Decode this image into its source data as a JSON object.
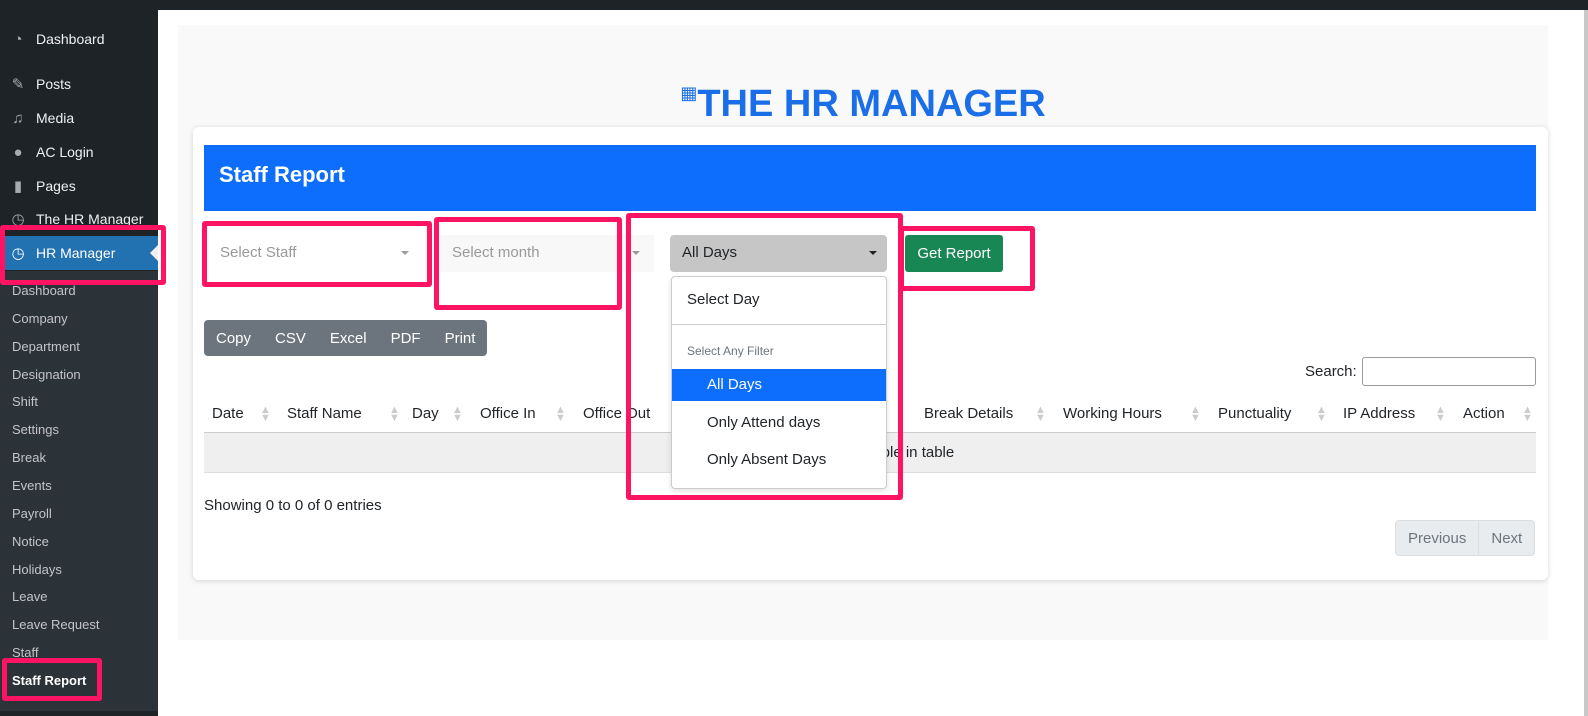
{
  "sidebar": {
    "items": [
      {
        "label": "Dashboard",
        "icon": "dashboard-icon"
      },
      {
        "label": "Posts",
        "icon": "pin-icon"
      },
      {
        "label": "Media",
        "icon": "media-icon"
      },
      {
        "label": "AC Login",
        "icon": "palette-icon"
      },
      {
        "label": "Pages",
        "icon": "pages-icon"
      },
      {
        "label": "The HR Manager",
        "icon": "clock-icon"
      },
      {
        "label": "HR Manager",
        "icon": "clock-icon"
      }
    ],
    "submenu": [
      "Dashboard",
      "Company",
      "Department",
      "Designation",
      "Shift",
      "Settings",
      "Break",
      "Events",
      "Payroll",
      "Notice",
      "Holidays",
      "Leave",
      "Leave Request",
      "Staff",
      "Staff Report"
    ]
  },
  "header": {
    "title": "THE HR MANAGER",
    "icon": "building-icon"
  },
  "card": {
    "title": "Staff Report"
  },
  "filters": {
    "staff_placeholder": "Select Staff",
    "month_placeholder": "Select month",
    "day_selected": "All Days",
    "get_report": "Get Report"
  },
  "day_menu": {
    "header_item": "Select Day",
    "group_label": "Select Any Filter",
    "options": [
      "All Days",
      "Only Attend days",
      "Only Absent Days"
    ],
    "selected": "All Days"
  },
  "export_buttons": [
    "Copy",
    "CSV",
    "Excel",
    "PDF",
    "Print"
  ],
  "search": {
    "label": "Search:",
    "value": ""
  },
  "table": {
    "columns": [
      "Date",
      "Staff Name",
      "Day",
      "Office In",
      "Office Out",
      "",
      "Break Details",
      "Working Hours",
      "Punctuality",
      "IP Address",
      "Action"
    ],
    "empty": "No data available in table"
  },
  "info": "Showing 0 to 0 of 0 entries",
  "pagination": {
    "previous": "Previous",
    "next": "Next"
  },
  "colors": {
    "accent": "#0d6efd",
    "highlight": "#ff1464",
    "success": "#198754"
  }
}
